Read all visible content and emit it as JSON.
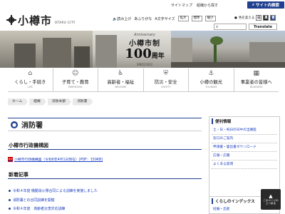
{
  "top": {
    "links": [
      "サイトマップ",
      "組織から探す"
    ],
    "site_search": "サイト内検索"
  },
  "logo": {
    "name": "小樽市",
    "sub": "OTARU CITY"
  },
  "tools": {
    "read_aloud": "読み上げ",
    "furigana": "ふりがな",
    "font_size_label": "文字サイズ",
    "zoom_in": "拡大",
    "standard": "標準",
    "zoom_out": "縮小",
    "color_label": "色を変える",
    "colors": [
      "白",
      "黒",
      "青"
    ],
    "translate": "Translate"
  },
  "banner": {
    "anniversary": "Anniversary",
    "title": "小樽市制",
    "hundred": "100",
    "unit": "周年",
    "since": "SINCE1922"
  },
  "nav": [
    {
      "label": "くらし・手続き",
      "en": "LIFE",
      "icon": "house-icon"
    },
    {
      "label": "子育て・教育",
      "en": "PARENTING",
      "icon": "family-icon"
    },
    {
      "label": "高齢者・福祉",
      "en": "WELFARE",
      "icon": "elderly-icon"
    },
    {
      "label": "防災・安全",
      "en": "SAFETY",
      "icon": "safety-icon"
    },
    {
      "label": "小樽の観光",
      "en": "TOURISM",
      "icon": "tourism-icon"
    },
    {
      "label": "事業者の皆様へ",
      "en": "BUSINESS",
      "icon": "business-icon"
    }
  ],
  "breadcrumb": [
    "ホーム",
    "組織",
    "消防本部",
    "消防署"
  ],
  "page_title": "消防署",
  "section1": {
    "heading": "小樽市行政機構図",
    "doc": "小樽市行政機構図（令和6年4月1日現在）[PDF：159KB]"
  },
  "section2": {
    "heading": "新着記事",
    "items": [
      "令和４年度 機動消火隊合同による訓練を実施しました",
      "消防署との合同訓練を開催",
      "令和４年度　高齢者災害対応訓練"
    ]
  },
  "sidebar": {
    "heading": "便利情報",
    "items": [
      "土・日・祝日の日中の当番医",
      "窓口のご案内",
      "申請書・届出書ダウンロード",
      "広報・広聴",
      "よくある質問"
    ],
    "heading2": "くらしのインデックス",
    "item2": "妊娠・出産"
  },
  "totop": {
    "line1": "このページの",
    "line2": "上へ戻る"
  }
}
